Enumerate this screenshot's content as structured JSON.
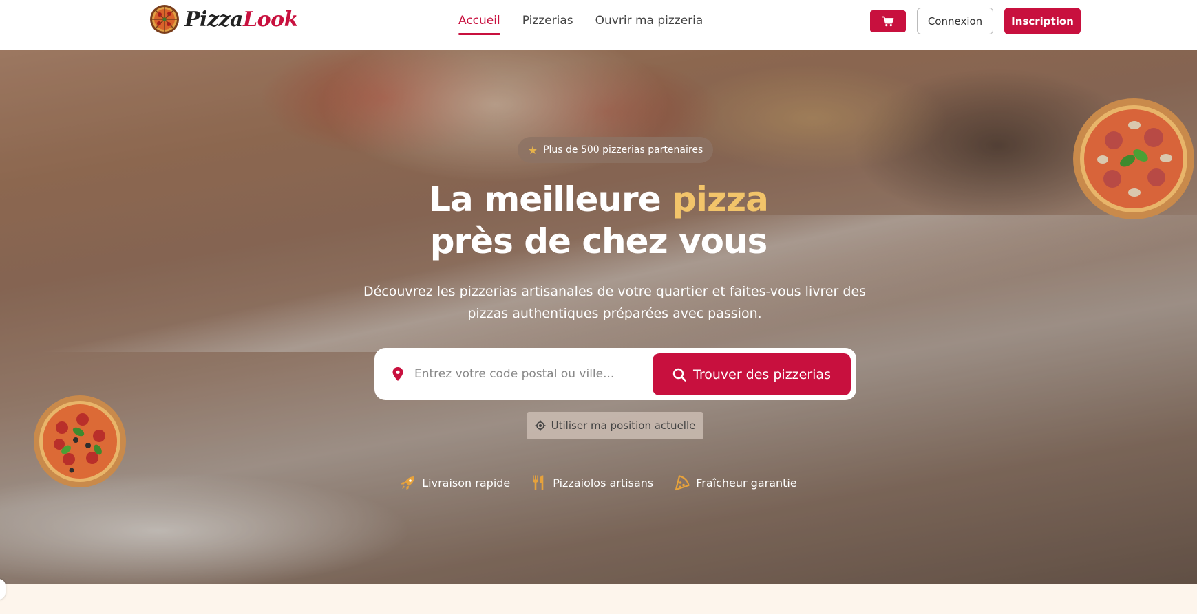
{
  "brand": {
    "name_part1": "Pizza",
    "name_part2": "Look",
    "primary_color": "#c8103e",
    "accent_color": "#f2c46a"
  },
  "nav": {
    "links": [
      {
        "label": "Accueil",
        "active": true
      },
      {
        "label": "Pizzerias",
        "active": false
      },
      {
        "label": "Ouvrir ma pizzeria",
        "active": false
      }
    ],
    "cart_icon": "shopping-cart-icon",
    "login_label": "Connexion",
    "signup_label": "Inscription"
  },
  "hero": {
    "badge": "Plus de 500 pizzerias partenaires",
    "title_line1_prefix": "La meilleure ",
    "title_line1_accent": "pizza",
    "title_line2": "près de chez vous",
    "subtitle": "Découvrez les pizzerias artisanales de votre quartier et faites-vous livrer des pizzas authentiques préparées avec passion.",
    "search": {
      "placeholder": "Entrez votre code postal ou ville...",
      "value": "",
      "button_label": "Trouver des pizzerias"
    },
    "geo_button_label": "Utiliser ma position actuelle",
    "features": [
      {
        "icon": "rocket-icon",
        "label": "Livraison rapide"
      },
      {
        "icon": "utensils-icon",
        "label": "Pizzaiolos artisans"
      },
      {
        "icon": "pizza-slice-icon",
        "label": "Fraîcheur garantie"
      }
    ]
  }
}
